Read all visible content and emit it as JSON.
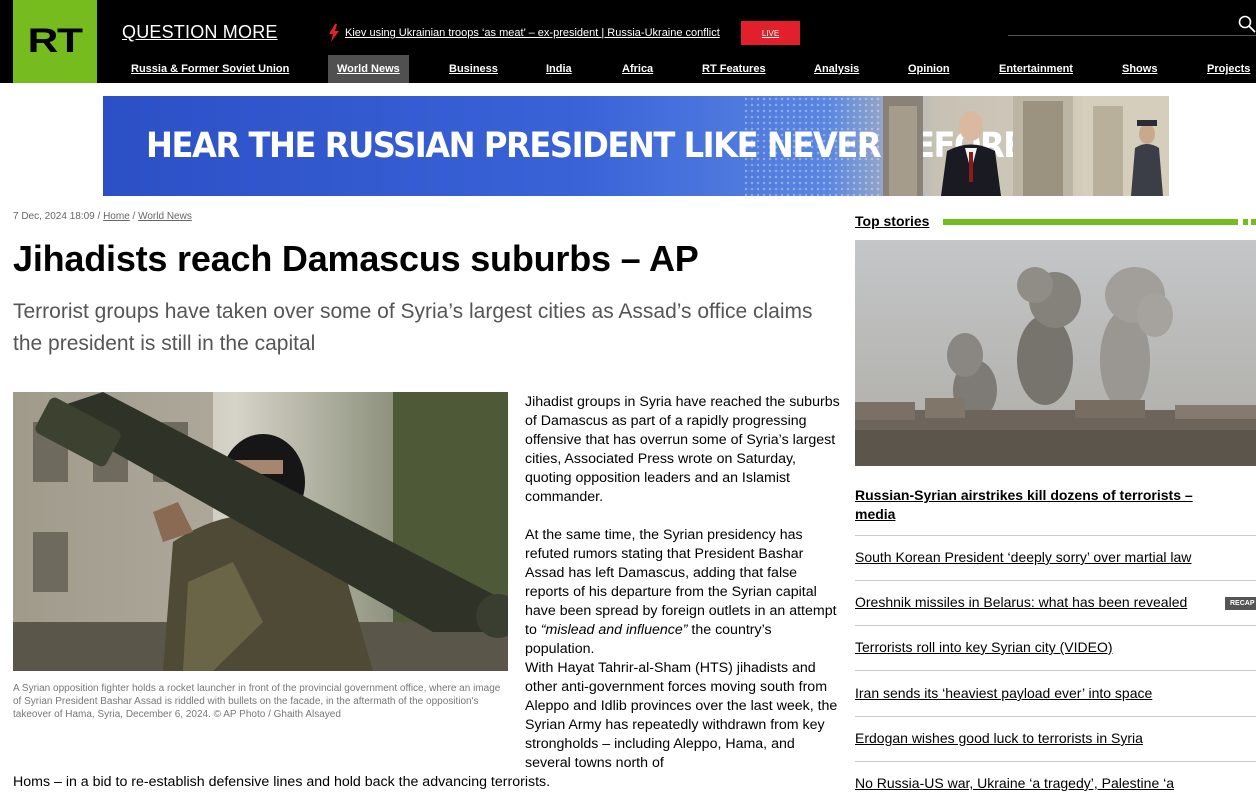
{
  "header": {
    "logo": "RT",
    "slogan": "QUESTION MORE",
    "breaking_news": "Kiev using Ukrainian troops ‘as meat’ – ex-president | Russia-Ukraine conflict",
    "live_label": "LIVE",
    "nav": [
      "Russia & Former Soviet Union",
      "World News",
      "Business",
      "India",
      "Africa",
      "RT Features",
      "Analysis",
      "Opinion",
      "Entertainment",
      "Shows",
      "Projects"
    ],
    "active_nav": "World News"
  },
  "banner": {
    "text": "HEAR THE RUSSIAN PRESIDENT LIKE NEVER BEFORE"
  },
  "article": {
    "date": "7 Dec, 2024 18:09",
    "breadcrumb": [
      "Home",
      "World News"
    ],
    "title": "Jihadists reach Damascus suburbs – AP",
    "summary": "Terrorist groups have taken over some of Syria’s largest cities as Assad’s office claims the president is still in the capital",
    "caption": "A Syrian opposition fighter holds a rocket launcher in front of the provincial government office, where an image of Syrian President Bashar Assad is riddled with bullets on the facade, in the aftermath of the opposition's takeover of Hama, Syria, December 6, 2024. ©  AP Photo / Ghaith Alsayed",
    "paragraph1": "Jihadist groups in Syria have reached the suburbs of Damascus as part of a rapidly progressing offensive that has overrun some of Syria’s largest cities, Associated Press wrote on Saturday, quoting opposition leaders and an Islamist commander.",
    "paragraph2_before": "At the same time, the Syrian presidency has refuted rumors stating that President Bashar Assad has left Damascus, adding that false reports of his departure from the Syrian capital have been spread by foreign outlets in an attempt to ",
    "paragraph2_quote": "“mislead and influence”",
    "paragraph2_after": " the country’s population.",
    "paragraph3": "With Hayat Tahrir-al-Sham (HTS) jihadists and other anti-government forces moving south from Aleppo and Idlib provinces over the last week, the Syrian Army has repeatedly withdrawn from key strongholds – including Aleppo, Hama, and several towns north of",
    "paragraph3_tail": "Homs – in a bid to re-establish defensive lines and hold back the advancing terrorists."
  },
  "sidebar": {
    "heading": "Top stories",
    "lead_story": "Russian-Syrian airstrikes kill dozens of terrorists – media",
    "stories": [
      "South Korean President ‘deeply sorry’ over martial law",
      "Oreshnik missiles in Belarus: what has been revealed",
      "Terrorists roll into key Syrian city (VIDEO)",
      "Iran sends its ‘heaviest payload ever’ into space",
      "Erdogan wishes good luck to terrorists in Syria",
      "No Russia-US war, Ukraine ‘a tragedy’, Palestine ‘a"
    ],
    "recap_badge": "RECAP"
  },
  "colors": {
    "brand_green": "#77bc1f",
    "live_red": "#e2202b",
    "header_bg": "#000000"
  }
}
